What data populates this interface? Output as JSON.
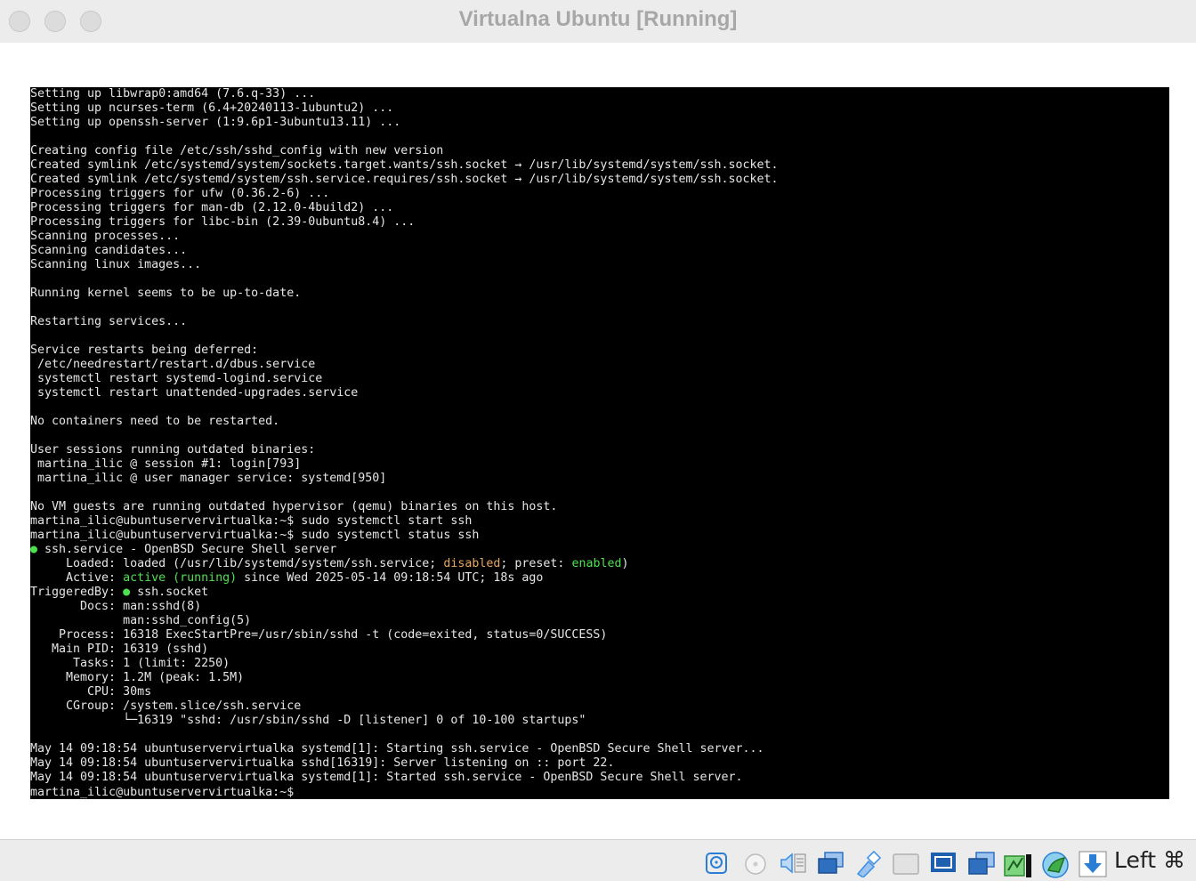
{
  "window": {
    "title": "Virtualna Ubuntu [Running]"
  },
  "terminal": {
    "lines": [
      [
        {
          "t": "Setting up libwrap0:amd64 (7.6.q-33) ..."
        }
      ],
      [
        {
          "t": "Setting up ncurses-term (6.4+20240113-1ubuntu2) ..."
        }
      ],
      [
        {
          "t": "Setting up openssh-server (1:9.6p1-3ubuntu13.11) ..."
        }
      ],
      [
        {
          "t": ""
        }
      ],
      [
        {
          "t": "Creating config file /etc/ssh/sshd_config with new version"
        }
      ],
      [
        {
          "t": "Created symlink /etc/systemd/system/sockets.target.wants/ssh.socket → /usr/lib/systemd/system/ssh.socket."
        }
      ],
      [
        {
          "t": "Created symlink /etc/systemd/system/ssh.service.requires/ssh.socket → /usr/lib/systemd/system/ssh.socket."
        }
      ],
      [
        {
          "t": "Processing triggers for ufw (0.36.2-6) ..."
        }
      ],
      [
        {
          "t": "Processing triggers for man-db (2.12.0-4build2) ..."
        }
      ],
      [
        {
          "t": "Processing triggers for libc-bin (2.39-0ubuntu8.4) ..."
        }
      ],
      [
        {
          "t": "Scanning processes..."
        }
      ],
      [
        {
          "t": "Scanning candidates..."
        }
      ],
      [
        {
          "t": "Scanning linux images..."
        }
      ],
      [
        {
          "t": ""
        }
      ],
      [
        {
          "t": "Running kernel seems to be up-to-date."
        }
      ],
      [
        {
          "t": ""
        }
      ],
      [
        {
          "t": "Restarting services..."
        }
      ],
      [
        {
          "t": ""
        }
      ],
      [
        {
          "t": "Service restarts being deferred:"
        }
      ],
      [
        {
          "t": " /etc/needrestart/restart.d/dbus.service"
        }
      ],
      [
        {
          "t": " systemctl restart systemd-logind.service"
        }
      ],
      [
        {
          "t": " systemctl restart unattended-upgrades.service"
        }
      ],
      [
        {
          "t": ""
        }
      ],
      [
        {
          "t": "No containers need to be restarted."
        }
      ],
      [
        {
          "t": ""
        }
      ],
      [
        {
          "t": "User sessions running outdated binaries:"
        }
      ],
      [
        {
          "t": " martina_ilic @ session #1: login[793]"
        }
      ],
      [
        {
          "t": " martina_ilic @ user manager service: systemd[950]"
        }
      ],
      [
        {
          "t": ""
        }
      ],
      [
        {
          "t": "No VM guests are running outdated hypervisor (qemu) binaries on this host."
        }
      ],
      [
        {
          "t": "martina_ilic@ubuntuservervirtualka:~$ sudo systemctl start ssh"
        }
      ],
      [
        {
          "t": "martina_ilic@ubuntuservervirtualka:~$ sudo systemctl status ssh"
        }
      ],
      [
        {
          "t": "●",
          "c": "g"
        },
        {
          "t": " ssh.service - OpenBSD Secure Shell server"
        }
      ],
      [
        {
          "t": "     Loaded: loaded (/usr/lib/systemd/system/ssh.service; "
        },
        {
          "t": "disabled",
          "c": "y"
        },
        {
          "t": "; preset: "
        },
        {
          "t": "enabled",
          "c": "g"
        },
        {
          "t": ")"
        }
      ],
      [
        {
          "t": "     Active: "
        },
        {
          "t": "active (running)",
          "c": "g"
        },
        {
          "t": " since Wed 2025-05-14 09:18:54 UTC; 18s ago"
        }
      ],
      [
        {
          "t": "TriggeredBy: "
        },
        {
          "t": "●",
          "c": "g"
        },
        {
          "t": " ssh.socket"
        }
      ],
      [
        {
          "t": "       Docs: man:sshd(8)"
        }
      ],
      [
        {
          "t": "             man:sshd_config(5)"
        }
      ],
      [
        {
          "t": "    Process: 16318 ExecStartPre=/usr/sbin/sshd -t (code=exited, status=0/SUCCESS)"
        }
      ],
      [
        {
          "t": "   Main PID: 16319 (sshd)"
        }
      ],
      [
        {
          "t": "      Tasks: 1 (limit: 2250)"
        }
      ],
      [
        {
          "t": "     Memory: 1.2M (peak: 1.5M)"
        }
      ],
      [
        {
          "t": "        CPU: 30ms"
        }
      ],
      [
        {
          "t": "     CGroup: /system.slice/ssh.service"
        }
      ],
      [
        {
          "t": "             └─16319 \"sshd: /usr/sbin/sshd -D [listener] 0 of 10-100 startups\""
        }
      ],
      [
        {
          "t": ""
        }
      ],
      [
        {
          "t": "May 14 09:18:54 ubuntuservervirtualka systemd[1]: Starting ssh.service - OpenBSD Secure Shell server..."
        }
      ],
      [
        {
          "t": "May 14 09:18:54 ubuntuservervirtualka sshd[16319]: Server listening on :: port 22."
        }
      ],
      [
        {
          "t": "May 14 09:18:54 ubuntuservervirtualka systemd[1]: Started ssh.service - OpenBSD Secure Shell server."
        }
      ],
      [
        {
          "t": "martina_ilic@ubuntuservervirtualka:~$ "
        }
      ]
    ]
  },
  "statusbar": {
    "icons": [
      {
        "name": "hard-disk-icon",
        "color": "#2a7fd4"
      },
      {
        "name": "optical-drive-icon",
        "color": "#bbbbbb"
      },
      {
        "name": "audio-icon",
        "color": "#3a8ee6"
      },
      {
        "name": "network-icon",
        "color": "#2f6fc0"
      },
      {
        "name": "usb-icon",
        "color": "#3a8ee6"
      },
      {
        "name": "shared-folders-icon",
        "color": "#c8c8c8"
      },
      {
        "name": "display-icon",
        "color": "#1f5fb0"
      },
      {
        "name": "video-capture-icon",
        "color": "#2f6fc0"
      },
      {
        "name": "cpu-activity-icon",
        "color": "#3fae49"
      },
      {
        "name": "mouse-integration-icon",
        "color": "#3fae49"
      },
      {
        "name": "keyboard-capture-icon",
        "color": "#2a7fd4"
      }
    ],
    "host_key": "Left ⌘"
  }
}
